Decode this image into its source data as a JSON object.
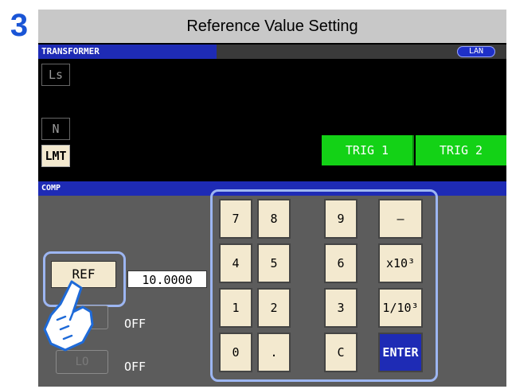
{
  "step_number": "3",
  "page_title": "Reference Value Setting",
  "header": {
    "mode": "TRANSFORMER",
    "lan_label": "LAN"
  },
  "side_buttons": {
    "ls": "Ls",
    "n": "N",
    "lmt": "LMT"
  },
  "trigger_buttons": {
    "trig1": "TRIG 1",
    "trig2": "TRIG 2"
  },
  "comp": {
    "section_label": "COMP",
    "ref_label": "REF",
    "ref_value": "10.0000",
    "hi_label": "",
    "hi_state": "OFF",
    "lo_label": "LO",
    "lo_state": "OFF"
  },
  "keypad": {
    "rows": [
      [
        "7",
        "8",
        "9",
        "–"
      ],
      [
        "4",
        "5",
        "6",
        "x10³"
      ],
      [
        "1",
        "2",
        "3",
        "1/10³"
      ],
      [
        "0",
        ".",
        "C",
        "ENTER"
      ]
    ]
  },
  "colors": {
    "accent_blue": "#1e2bb5",
    "trigger_green": "#13d216",
    "key_fill": "#f3e9cf",
    "highlight_outline": "#9db6f2"
  }
}
